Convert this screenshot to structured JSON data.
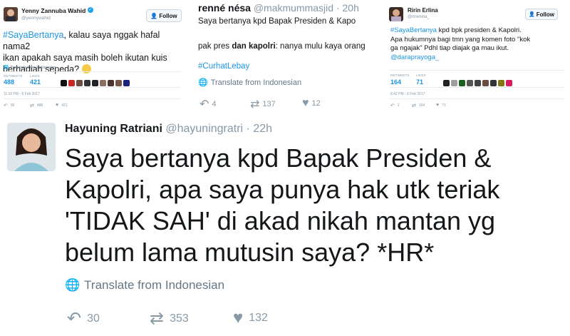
{
  "tweet1": {
    "name": "Yenny Zannuba Wahid",
    "handle": "@yennywahid",
    "follow_label": "Follow",
    "hashtag": "#SayaBertanya",
    "text_line1": ", kalau saya nggak hafal nama2",
    "text_line2": "ikan apakah saya masih boleh ikutan kuis",
    "text_line3": "berhadiah sepeda?",
    "translate": "Translate from Indonesian",
    "retweets_label": "RETWEETS",
    "retweets": "488",
    "likes_label": "LIKES",
    "likes": "421",
    "timestamp": "11:10 PM - 6 Feb 2017",
    "reply_count": "90",
    "retweet_count": "488",
    "like_count": "421"
  },
  "tweet2": {
    "name": "renné nésa",
    "handle": "@makmummasjid",
    "time": "· 20h",
    "line1": "Saya bertanya kpd Bapak Presiden & Kapo",
    "line2_pre": "pak pres ",
    "line2_bold": "dan kapolri",
    "line2_post": ": nanya mulu kaya orang",
    "hashtag": "#CurhatLebay",
    "translate": "Translate from Indonesian",
    "reply_count": "4",
    "retweet_count": "137",
    "like_count": "12"
  },
  "tweet3": {
    "name": "Ririn Erlina",
    "handle": "@ririenina_",
    "follow_label": "Follow",
    "hashtag": "#SayaBertanya",
    "line1": " kpd bpk presiden & Kapolri.",
    "line2": "Apa hukumnya bagi tmn yang komen foto \"kok",
    "line3": "ga ngajak\" Pdhl tiap diajak ga mau ikut.",
    "mention": "@daraprayoga_",
    "retweets_label": "RETWEETS",
    "retweets": "164",
    "likes_label": "LIKES",
    "likes": "71",
    "timestamp": "8:42 PM - 6 Feb 2017",
    "reply_count": "2",
    "retweet_count": "164",
    "like_count": "71"
  },
  "tweet4": {
    "name": "Hayuning Ratriani",
    "handle": "@hayuningratri",
    "time": "· 22h",
    "line1": "Saya bertanya kpd Bapak Presiden &",
    "line2": "Kapolri, apa saya punya hak utk teriak",
    "line3": "'TIDAK SAH' di akad nikah mantan yg",
    "line4": "belum lama mutusin saya? *HR*",
    "translate": "Translate from Indonesian",
    "reply_count": "30",
    "retweet_count": "353",
    "like_count": "132"
  },
  "colors": {
    "link_blue": "#1b95e0",
    "meta_grey": "#8899a6",
    "text": "#14171a"
  }
}
